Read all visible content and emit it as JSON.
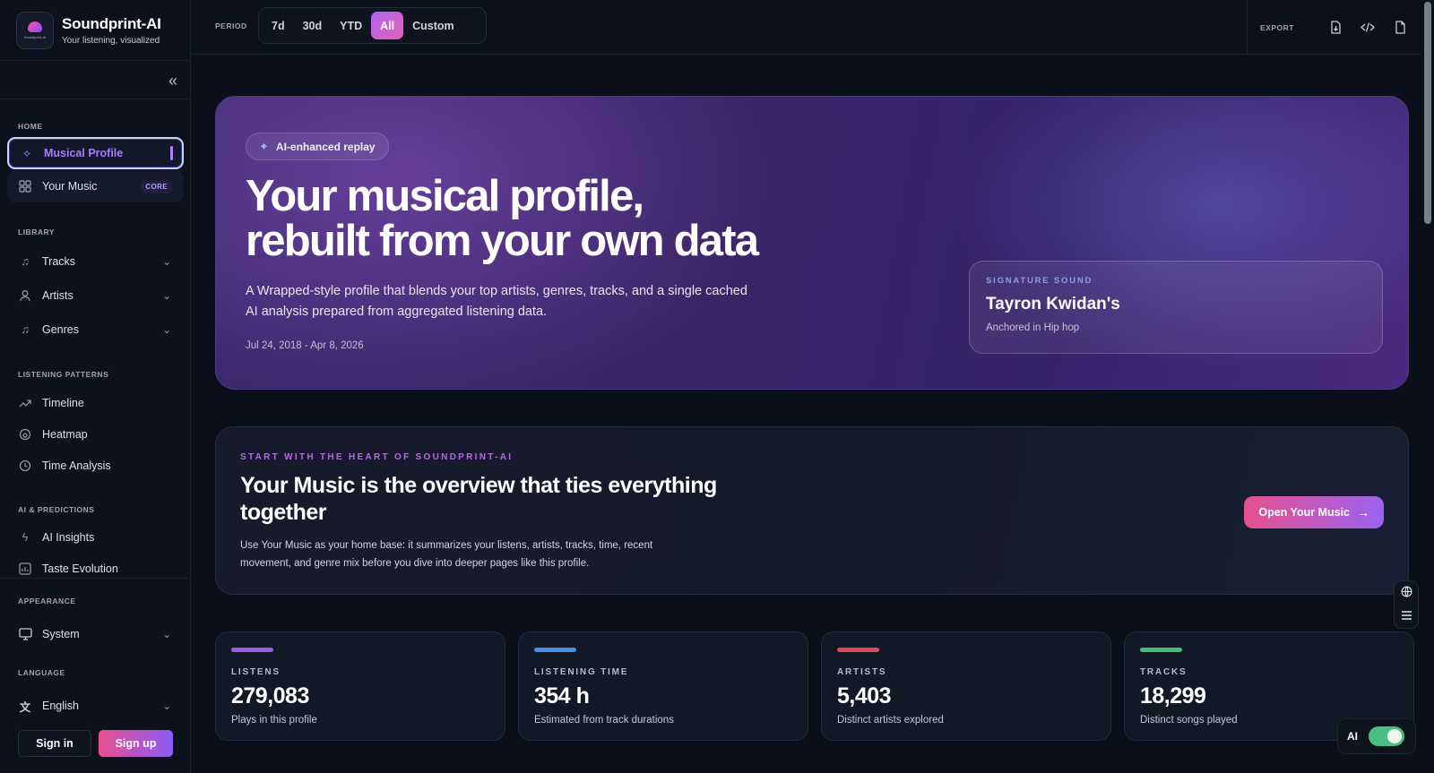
{
  "brand": {
    "name": "Soundprint-AI",
    "tagline": "Your listening, visualized",
    "logo_text": "Soundprint-AI"
  },
  "sidebar": {
    "sections": {
      "home": "HOME",
      "library": "LIBRARY",
      "patterns": "LISTENING PATTERNS",
      "ai": "AI & PREDICTIONS",
      "appearance": "APPEARANCE",
      "language": "LANGUAGE"
    },
    "items": {
      "musical_profile": "Musical Profile",
      "your_music": "Your Music",
      "core_badge": "CORE",
      "tracks": "Tracks",
      "artists": "Artists",
      "genres": "Genres",
      "timeline": "Timeline",
      "heatmap": "Heatmap",
      "time_analysis": "Time Analysis",
      "ai_insights": "AI Insights",
      "taste_evolution": "Taste Evolution",
      "system": "System",
      "english": "English"
    },
    "auth": {
      "sign_in": "Sign in",
      "sign_up": "Sign up"
    }
  },
  "topbar": {
    "period_label": "PERIOD",
    "periods": [
      "7d",
      "30d",
      "YTD",
      "All",
      "Custom"
    ],
    "active_period": "All",
    "export_label": "EXPORT"
  },
  "hero": {
    "badge": "AI-enhanced replay",
    "title_line1": "Your musical profile,",
    "title_line2": "rebuilt from your own data",
    "description": "A Wrapped-style profile that blends your top artists, genres, tracks, and a single cached AI analysis prepared from aggregated listening data.",
    "date_range": "Jul 24, 2018 - Apr 8, 2026",
    "signature": {
      "label": "SIGNATURE SOUND",
      "title": "Tayron Kwidan's",
      "subtitle": "Anchored in Hip hop"
    }
  },
  "heart": {
    "eyebrow": "START WITH THE HEART OF SOUNDPRINT-AI",
    "title": "Your Music is the overview that ties everything together",
    "description": "Use Your Music as your home base: it summarizes your listens, artists, tracks, time, recent movement, and genre mix before you dive into deeper pages like this profile.",
    "button": "Open Your Music",
    "button_arrow": "→"
  },
  "stats": [
    {
      "label": "LISTENS",
      "value": "279,083",
      "sub": "Plays in this profile",
      "color": "#9b5de5"
    },
    {
      "label": "LISTENING TIME",
      "value": "354 h",
      "sub": "Estimated from track durations",
      "color": "#4f8ee6"
    },
    {
      "label": "ARTISTS",
      "value": "5,403",
      "sub": "Distinct artists explored",
      "color": "#e0495f"
    },
    {
      "label": "TRACKS",
      "value": "18,299",
      "sub": "Distinct songs played",
      "color": "#3fbf7a"
    }
  ],
  "ai_toggle": {
    "label": "AI",
    "on": true
  }
}
